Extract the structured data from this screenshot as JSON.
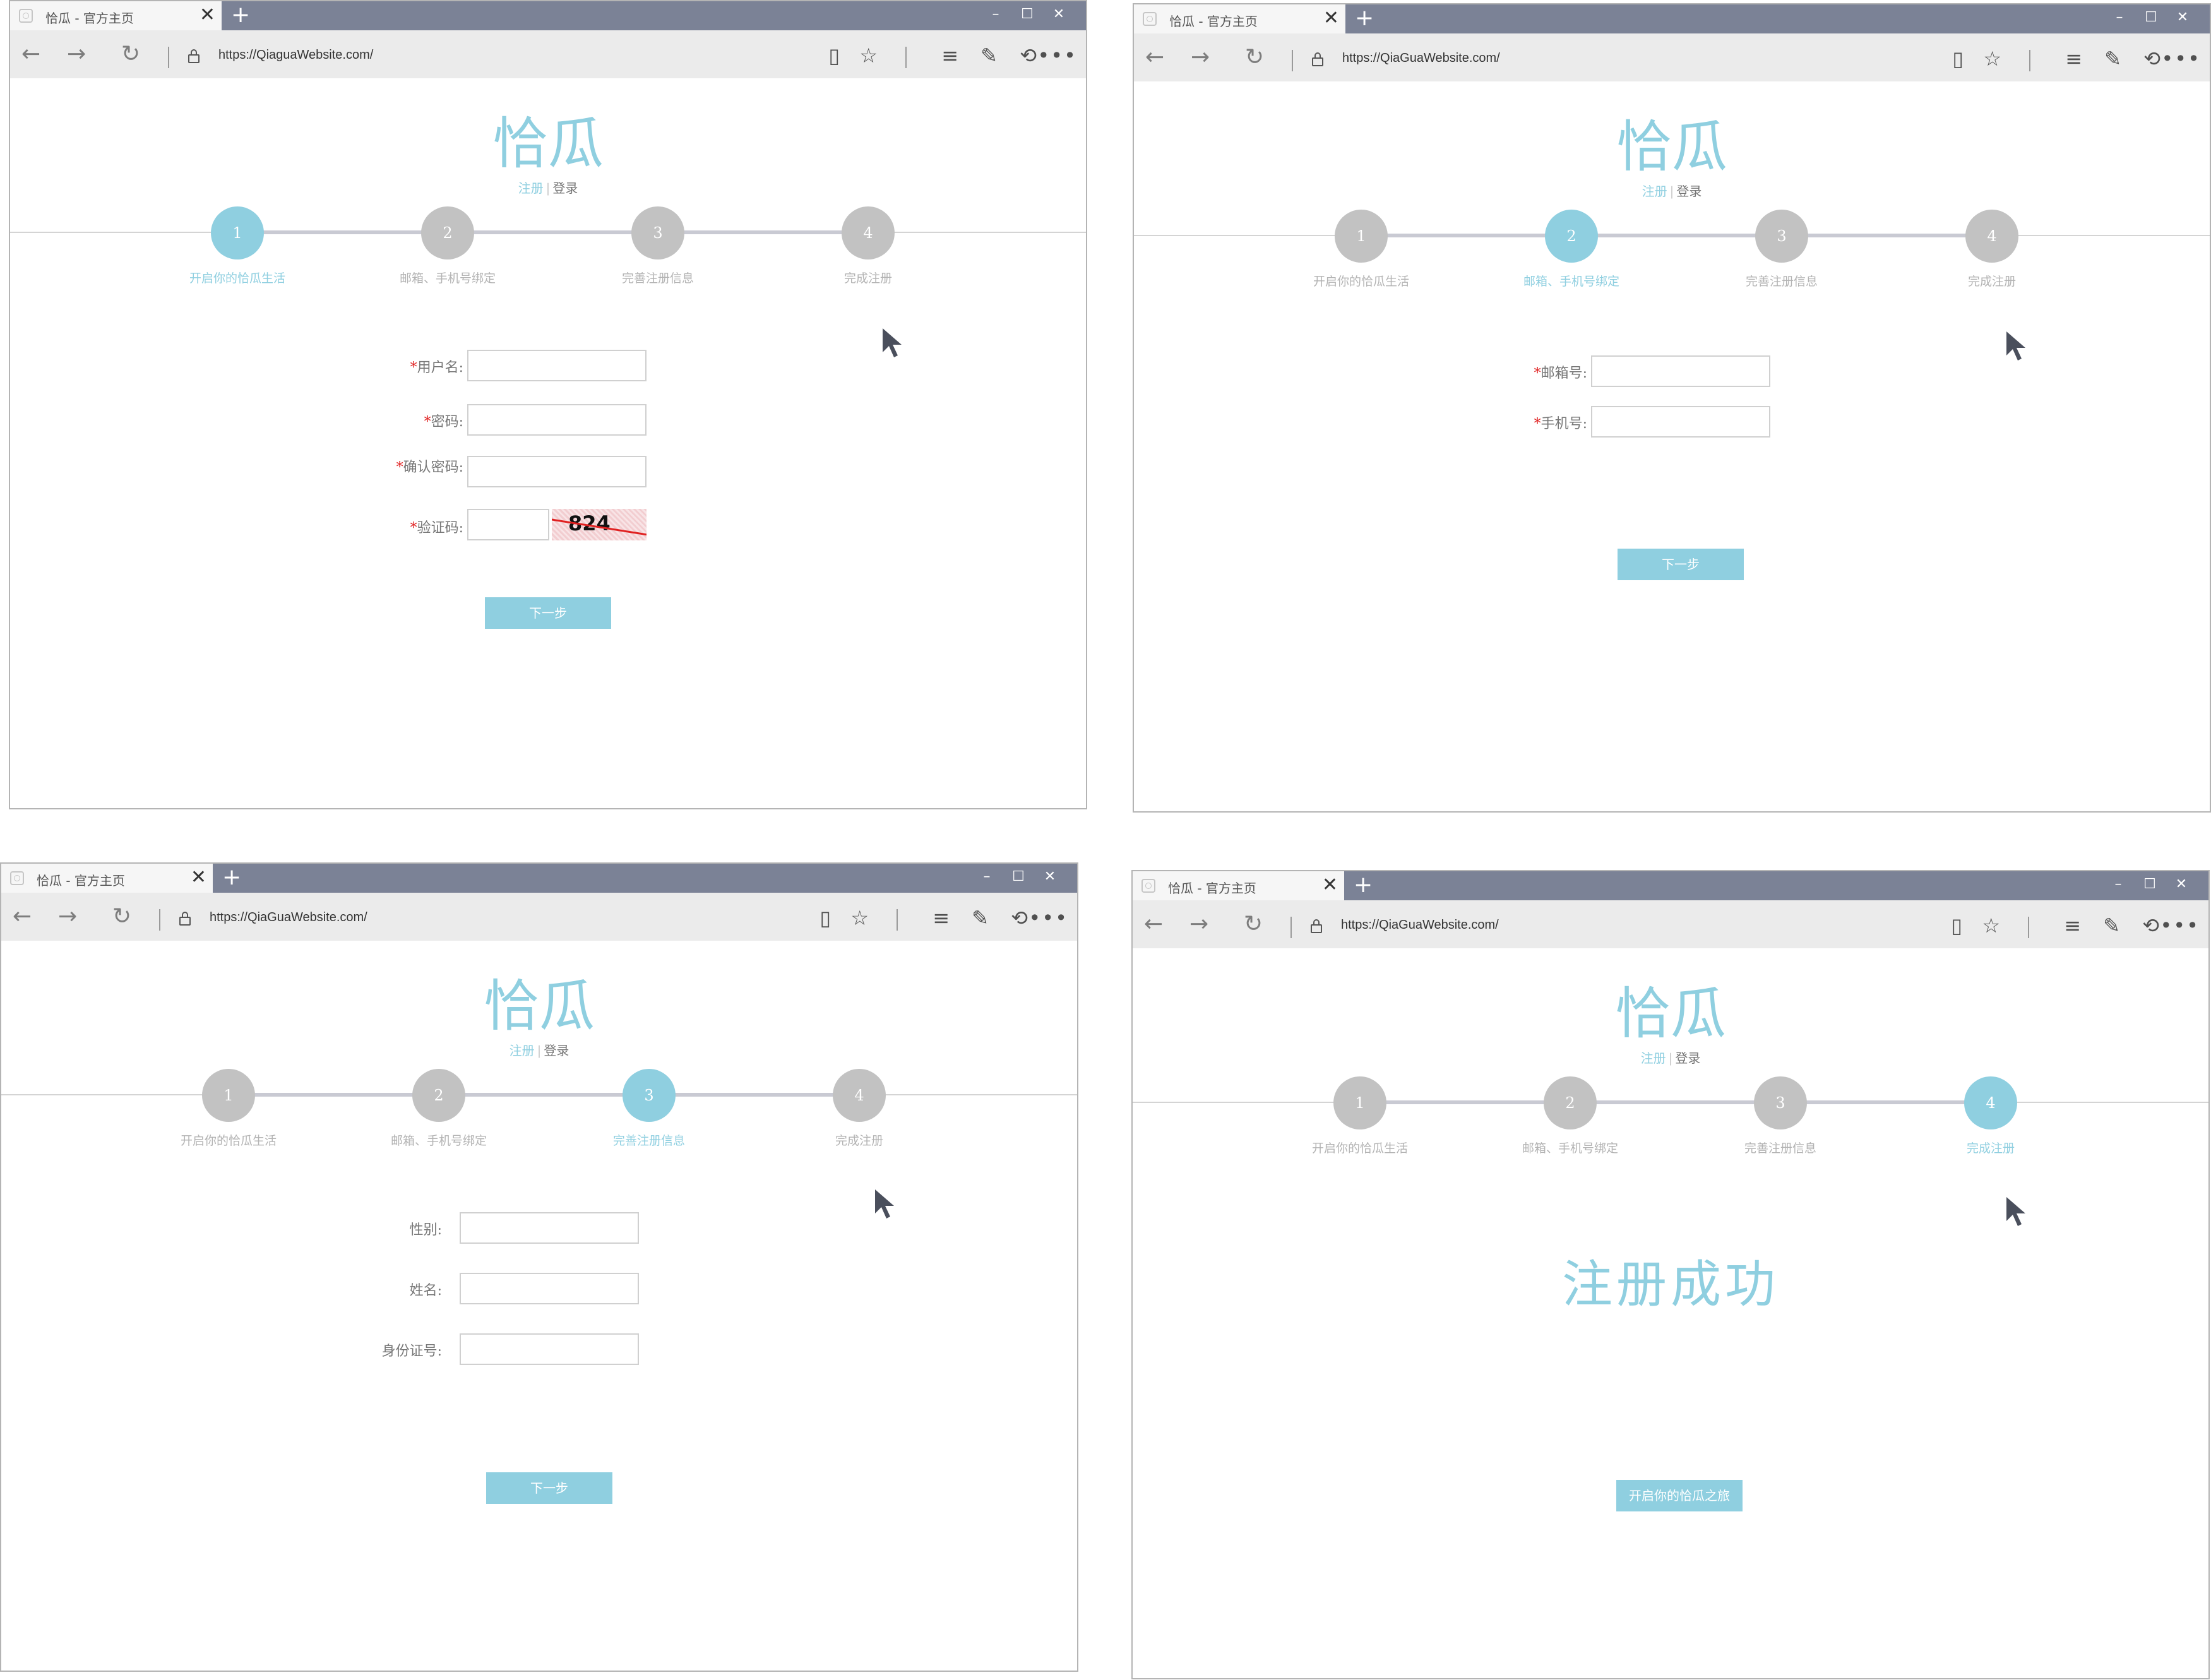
{
  "browser": {
    "tab_title": "恰瓜 - 官方主页",
    "tab_close": "✕",
    "new_tab": "+",
    "minimize": "–",
    "maximize": "☐",
    "close": "✕",
    "back": "←",
    "forward": "→",
    "reload": "↻",
    "toolbar_icons": [
      "reading-view-icon",
      "favorite-star-icon",
      "hub-icon",
      "web-note-icon",
      "share-icon",
      "more-icon"
    ],
    "urls": [
      "https://QiaguaWebsite.com/",
      "https://QiaGuaWebsite.com/",
      "https://QiaGuaWebsite.com/",
      "https://QiaGuaWebsite.com/"
    ]
  },
  "site": {
    "logo": "恰瓜",
    "register": "注册",
    "separator": "|",
    "login": "登录"
  },
  "steps": [
    {
      "number": "1",
      "label": "开启你的恰瓜生活"
    },
    {
      "number": "2",
      "label": "邮箱、手机号绑定"
    },
    {
      "number": "3",
      "label": "完善注册信息"
    },
    {
      "number": "4",
      "label": "完成注册"
    }
  ],
  "step1": {
    "required_mark": "*",
    "username_label": "用户名:",
    "password_label": "密码:",
    "confirm_label": "确认密码:",
    "captcha_label": "验证码:",
    "captcha_text": "824",
    "next_button": "下一步"
  },
  "step2": {
    "required_mark": "*",
    "email_label": "邮箱号:",
    "phone_label": "手机号:",
    "next_button": "下一步"
  },
  "step3": {
    "gender_label": "性别:",
    "name_label": "姓名:",
    "id_label": "身份证号:",
    "next_button": "下一步"
  },
  "step4": {
    "success_text": "注册成功",
    "start_button": "开启你的恰瓜之旅"
  },
  "colors": {
    "accent": "#8fcfe0",
    "step_inactive": "#c2c2c2",
    "tabbar": "#7b8296",
    "required": "#e02020"
  }
}
